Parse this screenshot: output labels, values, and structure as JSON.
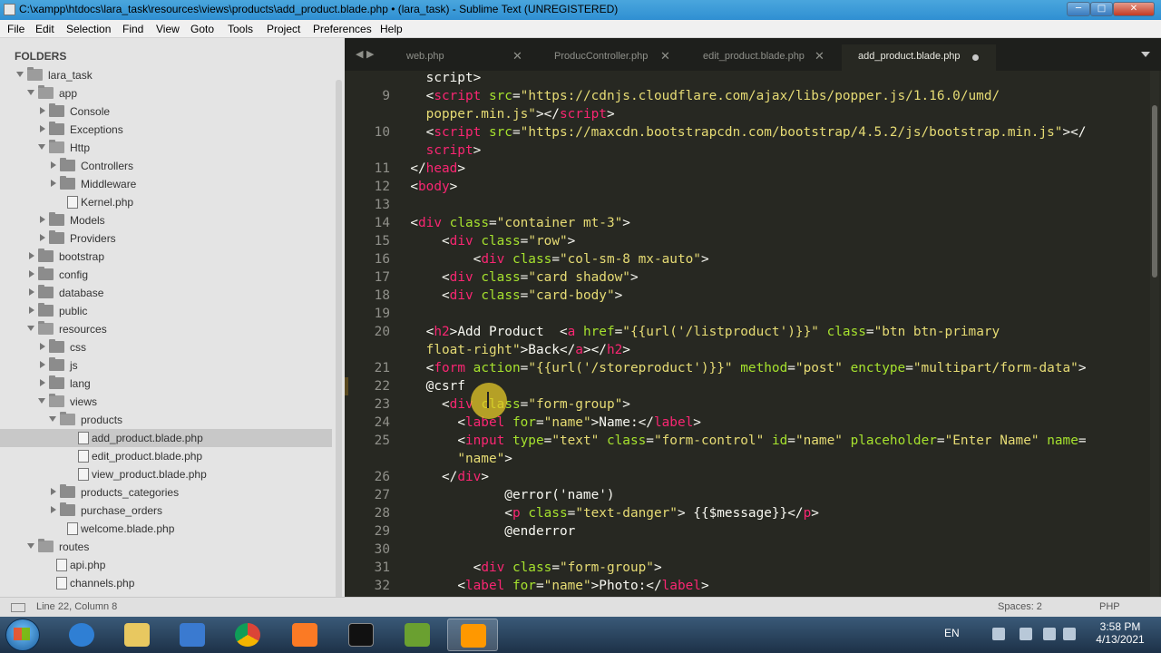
{
  "window": {
    "title": "C:\\xampp\\htdocs\\lara_task\\resources\\views\\products\\add_product.blade.php • (lara_task) - Sublime Text (UNREGISTERED)",
    "minimize": "─",
    "maximize": "□",
    "close": "✕"
  },
  "menu": [
    "File",
    "Edit",
    "Selection",
    "Find",
    "View",
    "Goto",
    "Tools",
    "Project",
    "Preferences",
    "Help"
  ],
  "sidebar": {
    "title": "FOLDERS",
    "items": [
      {
        "label": "lara_task",
        "kind": "folder-open"
      },
      {
        "label": "app",
        "kind": "folder-open"
      },
      {
        "label": "Console",
        "kind": "folder"
      },
      {
        "label": "Exceptions",
        "kind": "folder"
      },
      {
        "label": "Http",
        "kind": "folder-open"
      },
      {
        "label": "Controllers",
        "kind": "folder"
      },
      {
        "label": "Middleware",
        "kind": "folder"
      },
      {
        "label": "Kernel.php",
        "kind": "file"
      },
      {
        "label": "Models",
        "kind": "folder"
      },
      {
        "label": "Providers",
        "kind": "folder"
      },
      {
        "label": "bootstrap",
        "kind": "folder"
      },
      {
        "label": "config",
        "kind": "folder"
      },
      {
        "label": "database",
        "kind": "folder"
      },
      {
        "label": "public",
        "kind": "folder"
      },
      {
        "label": "resources",
        "kind": "folder-open"
      },
      {
        "label": "css",
        "kind": "folder"
      },
      {
        "label": "js",
        "kind": "folder"
      },
      {
        "label": "lang",
        "kind": "folder"
      },
      {
        "label": "views",
        "kind": "folder-open"
      },
      {
        "label": "products",
        "kind": "folder-open"
      },
      {
        "label": "add_product.blade.php",
        "kind": "file",
        "selected": true
      },
      {
        "label": "edit_product.blade.php",
        "kind": "file"
      },
      {
        "label": "view_product.blade.php",
        "kind": "file"
      },
      {
        "label": "products_categories",
        "kind": "folder"
      },
      {
        "label": "purchase_orders",
        "kind": "folder"
      },
      {
        "label": "welcome.blade.php",
        "kind": "file"
      },
      {
        "label": "routes",
        "kind": "folder-open"
      },
      {
        "label": "api.php",
        "kind": "file"
      },
      {
        "label": "channels.php",
        "kind": "file"
      }
    ]
  },
  "tabs": [
    {
      "label": "web.php",
      "active": false
    },
    {
      "label": "ProducController.php",
      "active": false
    },
    {
      "label": "edit_product.blade.php",
      "active": false
    },
    {
      "label": "add_product.blade.php",
      "active": true,
      "dirty": true
    }
  ],
  "tab_nav": "◀ ▶",
  "tab_close_glyph": "✕",
  "editor": {
    "lines": [
      {
        "num": "",
        "code": "    <span class=\"w\">script</span><span class=\"w\">&gt;</span>"
      },
      {
        "num": "9",
        "code": "    <span class=\"w\">&lt;</span><span class=\"t\">script</span> <span class=\"a\">src</span>=<span class=\"s\">\"https://cdnjs.cloudflare.com/ajax/libs/popper.js/1.16.0/umd/</span>"
      },
      {
        "num": "",
        "code": "    <span class=\"s\">popper.min.js\"</span><span class=\"w\">&gt;&lt;/</span><span class=\"t\">script</span><span class=\"w\">&gt;</span>"
      },
      {
        "num": "10",
        "code": "    <span class=\"w\">&lt;</span><span class=\"t\">script</span> <span class=\"a\">src</span>=<span class=\"s\">\"https://maxcdn.bootstrapcdn.com/bootstrap/4.5.2/js/bootstrap.min.js\"</span><span class=\"w\">&gt;&lt;/</span>"
      },
      {
        "num": "",
        "code": "    <span class=\"t\">script</span><span class=\"w\">&gt;</span>"
      },
      {
        "num": "11",
        "code": "  <span class=\"w\">&lt;/</span><span class=\"t\">head</span><span class=\"w\">&gt;</span>"
      },
      {
        "num": "12",
        "code": "  <span class=\"w\">&lt;</span><span class=\"t\">body</span><span class=\"w\">&gt;</span>"
      },
      {
        "num": "13",
        "code": ""
      },
      {
        "num": "14",
        "code": "  <span class=\"w\">&lt;</span><span class=\"t\">div</span> <span class=\"a\">class</span>=<span class=\"s\">\"container mt-3\"</span><span class=\"w\">&gt;</span>"
      },
      {
        "num": "15",
        "code": "      <span class=\"w\">&lt;</span><span class=\"t\">div</span> <span class=\"a\">class</span>=<span class=\"s\">\"row\"</span><span class=\"w\">&gt;</span>"
      },
      {
        "num": "16",
        "code": "          <span class=\"w\">&lt;</span><span class=\"t\">div</span> <span class=\"a\">class</span>=<span class=\"s\">\"col-sm-8 mx-auto\"</span><span class=\"w\">&gt;</span>"
      },
      {
        "num": "17",
        "code": "      <span class=\"w\">&lt;</span><span class=\"t\">div</span> <span class=\"a\">class</span>=<span class=\"s\">\"card shadow\"</span><span class=\"w\">&gt;</span>"
      },
      {
        "num": "18",
        "code": "      <span class=\"w\">&lt;</span><span class=\"t\">div</span> <span class=\"a\">class</span>=<span class=\"s\">\"card-body\"</span><span class=\"w\">&gt;</span>"
      },
      {
        "num": "19",
        "code": ""
      },
      {
        "num": "20",
        "code": "    <span class=\"w\">&lt;</span><span class=\"t\">h2</span><span class=\"w\">&gt;Add Product  &lt;</span><span class=\"t\">a</span> <span class=\"a\">href</span>=<span class=\"s\">\"{{url('/listproduct')}}\"</span> <span class=\"a\">class</span>=<span class=\"s\">\"btn btn-primary</span>"
      },
      {
        "num": "",
        "code": "    <span class=\"s\">float-right\"</span><span class=\"w\">&gt;Back&lt;/</span><span class=\"t\">a</span><span class=\"w\">&gt;&lt;/</span><span class=\"t\">h2</span><span class=\"w\">&gt;</span>"
      },
      {
        "num": "21",
        "code": "    <span class=\"w\">&lt;</span><span class=\"t\">form</span> <span class=\"a\">action</span>=<span class=\"s\">\"{{url('/storeproduct')}}\"</span> <span class=\"a\">method</span>=<span class=\"s\">\"post\"</span> <span class=\"a\">enctype</span>=<span class=\"s\">\"multipart/form-data\"</span><span class=\"w\">&gt;</span>"
      },
      {
        "num": "22",
        "code": "    <span class=\"w\">@csrf</span>"
      },
      {
        "num": "23",
        "code": "      <span class=\"w\">&lt;</span><span class=\"t\">div</span> <span class=\"a\">class</span>=<span class=\"s\">\"form-group\"</span><span class=\"w\">&gt;</span>"
      },
      {
        "num": "24",
        "code": "        <span class=\"w\">&lt;</span><span class=\"t\">label</span> <span class=\"a\">for</span>=<span class=\"s\">\"name\"</span><span class=\"w\">&gt;Name:&lt;/</span><span class=\"t\">label</span><span class=\"w\">&gt;</span>"
      },
      {
        "num": "25",
        "code": "        <span class=\"w\">&lt;</span><span class=\"t\">input</span> <span class=\"a\">type</span>=<span class=\"s\">\"text\"</span> <span class=\"a\">class</span>=<span class=\"s\">\"form-control\"</span> <span class=\"a\">id</span>=<span class=\"s\">\"name\"</span> <span class=\"a\">placeholder</span>=<span class=\"s\">\"Enter Name\"</span> <span class=\"a\">name</span>="
      },
      {
        "num": "",
        "code": "        <span class=\"s\">\"name\"</span><span class=\"w\">&gt;</span>"
      },
      {
        "num": "26",
        "code": "      <span class=\"w\">&lt;/</span><span class=\"t\">div</span><span class=\"w\">&gt;</span>"
      },
      {
        "num": "27",
        "code": "              <span class=\"w\">@error('name')</span>"
      },
      {
        "num": "28",
        "code": "              <span class=\"w\">&lt;</span><span class=\"t\">p</span> <span class=\"a\">class</span>=<span class=\"s\">\"text-danger\"</span><span class=\"w\">&gt; {{$message}}&lt;/</span><span class=\"t\">p</span><span class=\"w\">&gt;</span>"
      },
      {
        "num": "29",
        "code": "              <span class=\"w\">@enderror</span>"
      },
      {
        "num": "30",
        "code": ""
      },
      {
        "num": "31",
        "code": "          <span class=\"w\">&lt;</span><span class=\"t\">div</span> <span class=\"a\">class</span>=<span class=\"s\">\"form-group\"</span><span class=\"w\">&gt;</span>"
      },
      {
        "num": "32",
        "code": "        <span class=\"w\">&lt;</span><span class=\"t\">label</span> <span class=\"a\">for</span>=<span class=\"s\">\"name\"</span><span class=\"w\">&gt;Photo:&lt;/</span><span class=\"t\">label</span><span class=\"w\">&gt;</span>"
      }
    ]
  },
  "status": {
    "position": "Line 22, Column 8",
    "indent": "Spaces: 2",
    "syntax": "PHP"
  },
  "taskbar": {
    "language": "EN",
    "time": "3:58 PM",
    "date": "4/13/2021"
  },
  "colors": {
    "editor_bg": "#272822",
    "tag": "#f92672",
    "attribute": "#a6e22e",
    "string": "#e6db74",
    "text": "#f8f8f2",
    "cursor_highlight": "#e6c828"
  }
}
